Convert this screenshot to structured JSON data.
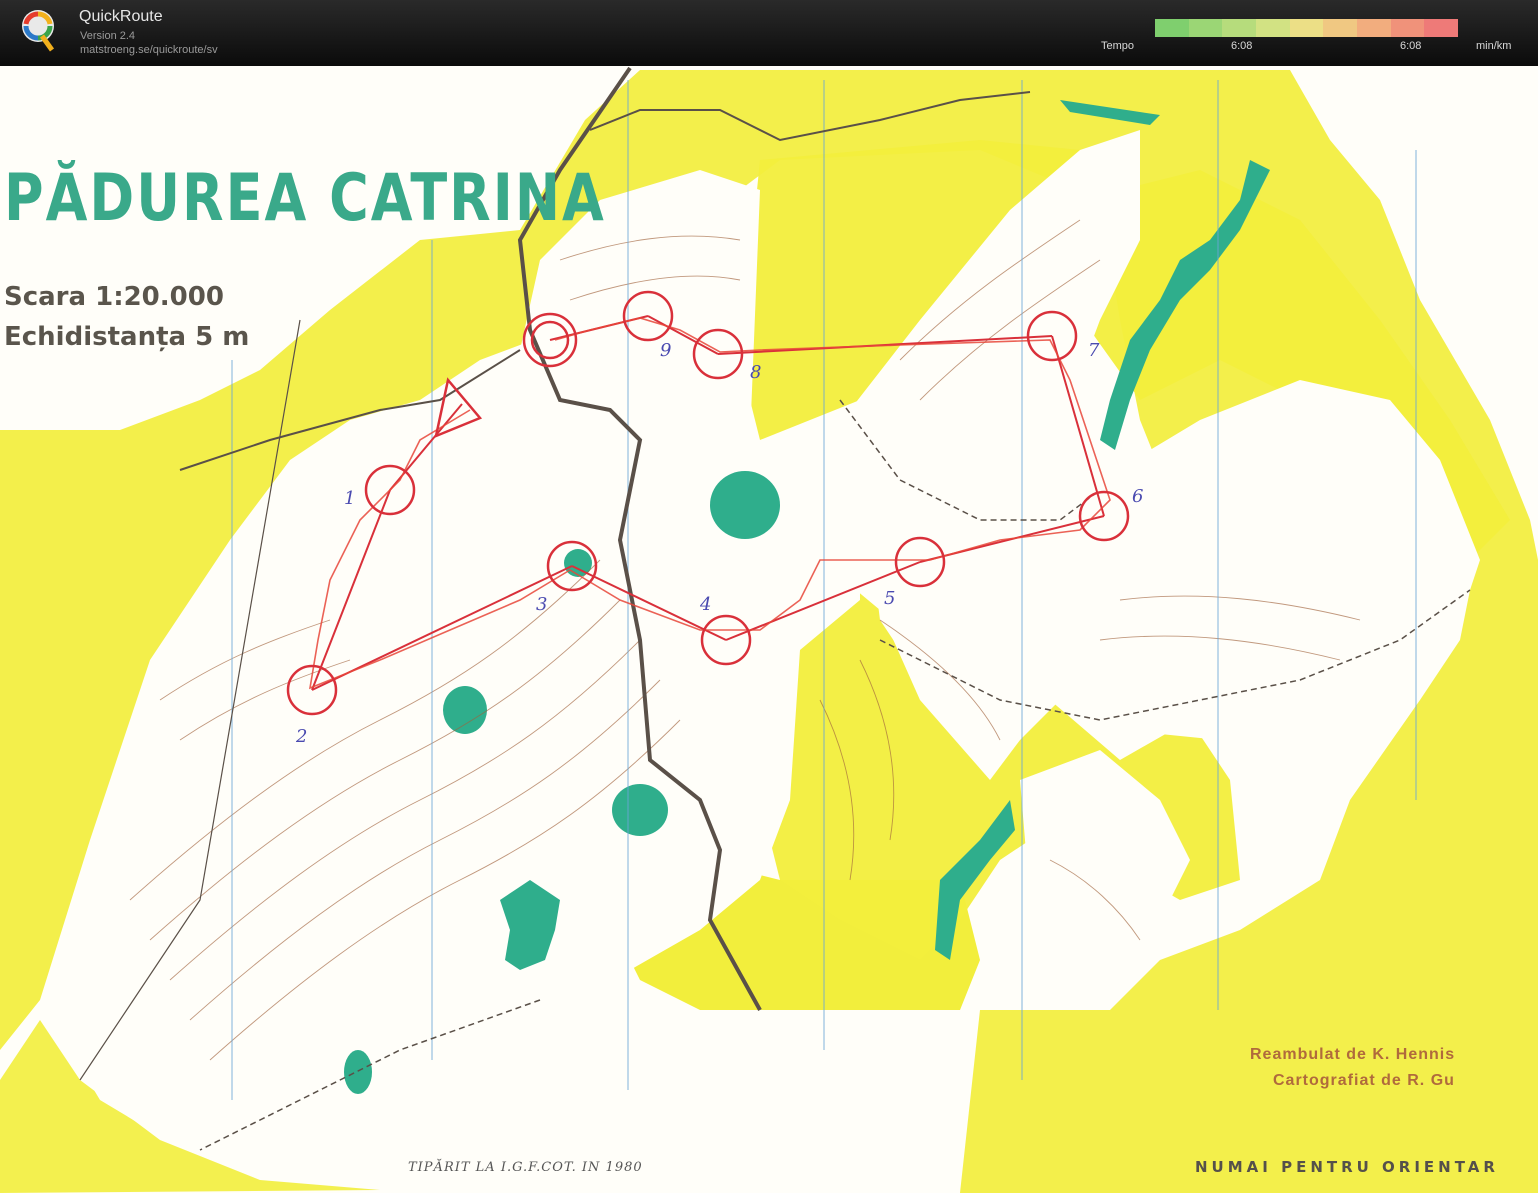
{
  "app": {
    "title": "QuickRoute",
    "version": "Version 2.4",
    "url": "matstroeng.se/quickroute/sv",
    "logo_letter": "Q"
  },
  "tempo": {
    "label": "Tempo",
    "min_value": "6:08",
    "max_value": "6:08",
    "unit": "min/km",
    "gradient_colors": [
      "#7fcf6e",
      "#9bd675",
      "#b6dc7c",
      "#d2e283",
      "#ecdf86",
      "#f0c882",
      "#f2ad7e",
      "#f0927a",
      "#ee7a78"
    ]
  },
  "map": {
    "title": "PĂDUREA CATRINA",
    "scale": "Scara 1:20.000",
    "contour_interval": "Echidistanța   5 m",
    "printed": "TIPĂRIT  LA  I.G.F.COT.  IN  1980",
    "credit_line_1": "Reambulat de K. Hennis",
    "credit_line_2": "Cartografiat de R. Gu",
    "footer": "NUMAI  PENTRU  ORIENTAR",
    "colors": {
      "open_land": "#f2ee3c",
      "green": "#2fae8c",
      "course": "#d9303a",
      "contour": "#a0623c",
      "road": "#5a5048"
    },
    "controls": [
      {
        "number": "1"
      },
      {
        "number": "2"
      },
      {
        "number": "3"
      },
      {
        "number": "4"
      },
      {
        "number": "5"
      },
      {
        "number": "6"
      },
      {
        "number": "7"
      },
      {
        "number": "8"
      },
      {
        "number": "9"
      }
    ]
  }
}
